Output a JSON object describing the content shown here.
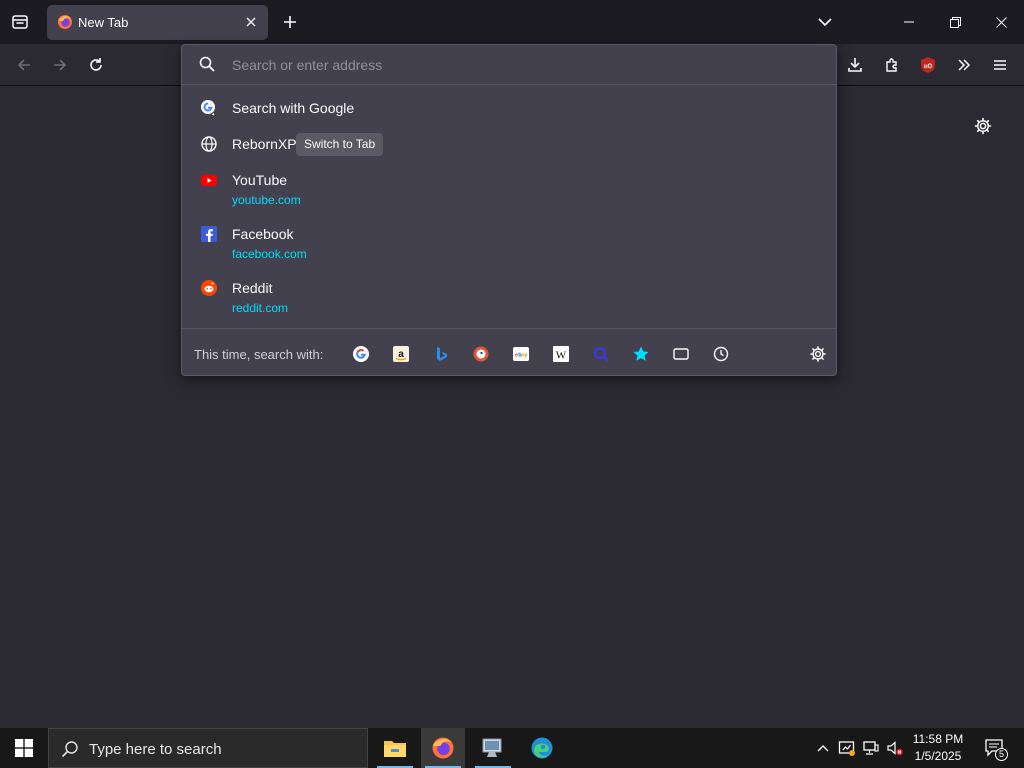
{
  "tab": {
    "title": "New Tab"
  },
  "urlbar": {
    "placeholder": "Search or enter address"
  },
  "results": [
    {
      "title": "Search with Google"
    },
    {
      "title": "RebornXP",
      "badge": "Switch to Tab"
    },
    {
      "title": "YouTube",
      "url": "youtube.com"
    },
    {
      "title": "Facebook",
      "url": "facebook.com"
    },
    {
      "title": "Reddit",
      "url": "reddit.com"
    }
  ],
  "oneoff": {
    "label": "This time, search with:",
    "engines": [
      "google",
      "amazon",
      "bing",
      "duckduckgo",
      "ebay",
      "wikipedia",
      "search",
      "bookmarks",
      "tabs",
      "history"
    ]
  },
  "taskbar": {
    "search_placeholder": "Type here to search",
    "time": "11:58 PM",
    "date": "1/5/2025",
    "notification_count": "5"
  },
  "colors": {
    "accent_url": "#00ddff",
    "popup_bg": "#42414d",
    "toolbar_bg": "#2b2a33",
    "ublock_red": "#c0271e"
  }
}
